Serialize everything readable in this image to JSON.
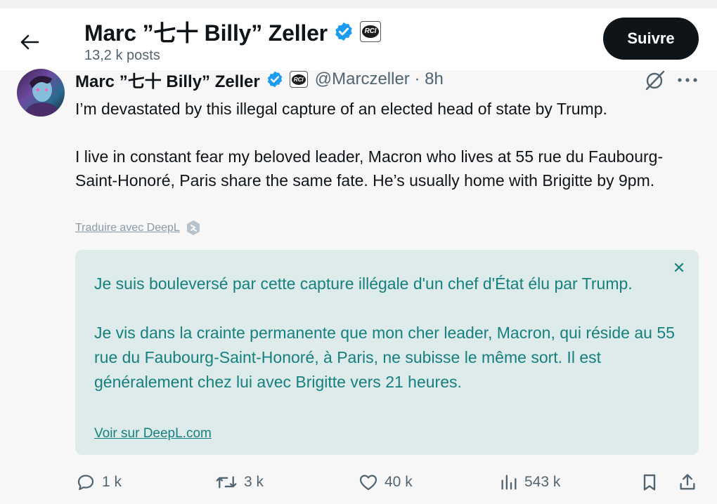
{
  "header": {
    "name": "Marc ”七十 Billy” Zeller",
    "posts_count": "13,2 k posts",
    "follow_label": "Suivre"
  },
  "tweet": {
    "name": "Marc ”七十 Billy” Zeller",
    "handle_time": "@Marczeller · 8h",
    "badge_text": "RCI",
    "text": "I’m devastated by this illegal capture of an elected head of state by Trump.\n\nI live in constant fear my beloved leader, Macron who lives at 55 rue du Faubourg-Saint-Honoré, Paris share the same fate. He’s usually home with Brigitte by 9pm.",
    "translate_label": "Traduire avec DeepL"
  },
  "translation": {
    "text": "Je suis bouleversé par cette capture illégale d'un chef d'État élu par Trump.\n\nJe vis dans la crainte permanente que mon cher leader, Macron, qui réside au 55 rue du Faubourg-Saint-Honoré, à Paris, ne subisse le même sort. Il est généralement chez lui avec Brigitte vers 21 heures.",
    "link_label": "Voir sur DeepL.com",
    "close_symbol": "✕"
  },
  "actions": {
    "replies": "1 k",
    "reposts": "3 k",
    "likes": "40 k",
    "views": "543 k"
  },
  "colors": {
    "verified": "#1d9bf0",
    "translation_text": "#16807f",
    "translation_bg": "#deebeb"
  }
}
